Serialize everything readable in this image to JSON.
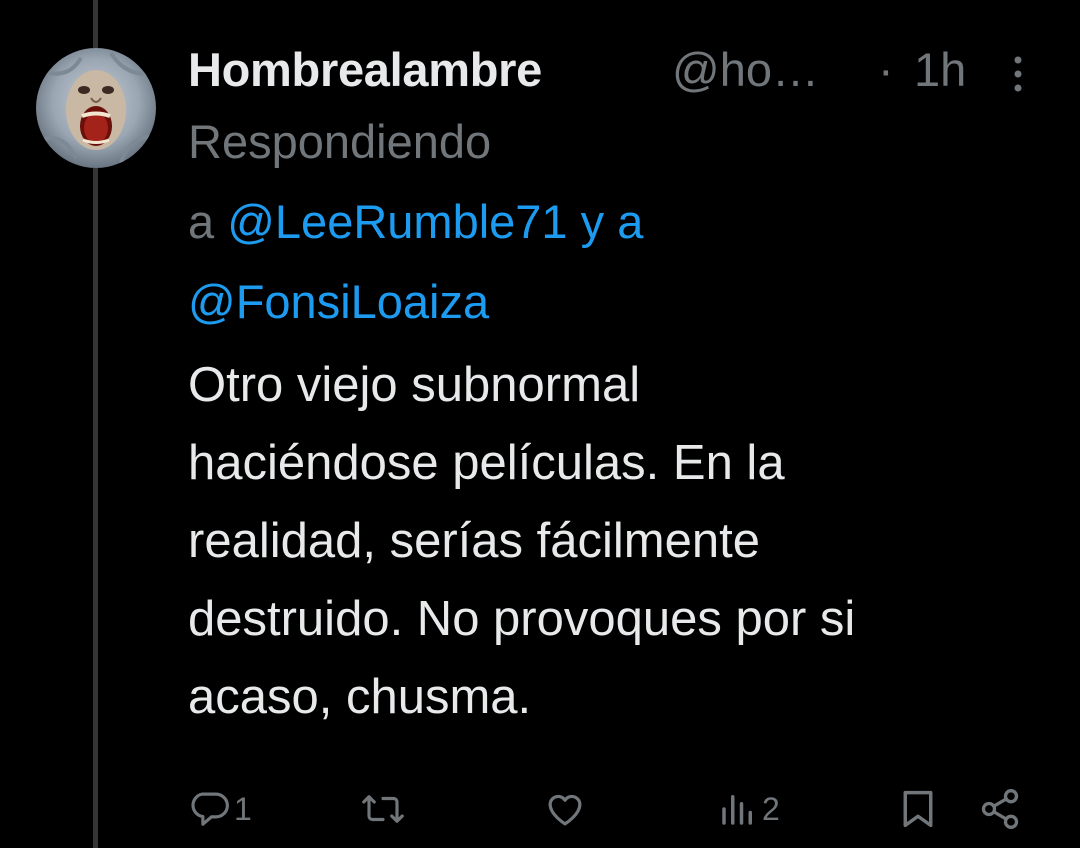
{
  "tweet": {
    "author": {
      "name": "Hombrealambre",
      "handle": "@ho…",
      "avatar_icon": "screaming-face-avatar"
    },
    "separator": "·",
    "time": "1h",
    "replying": {
      "label": "Respondiendo",
      "prefix": "a",
      "mention_1": "@LeeRumble71",
      "conjunction": "y a",
      "mention_2": "@FonsiLoaiza"
    },
    "text_lines": [
      "Otro viejo subnormal",
      "haciéndose películas. En la",
      "realidad, serías fácilmente",
      "destruido. No provoques por si",
      "acaso, chusma."
    ],
    "actions": {
      "reply_count": "1",
      "retweet_count": "",
      "like_count": "",
      "views_count": "2"
    }
  },
  "colors": {
    "background": "#000000",
    "text_primary": "#e7e9ea",
    "text_secondary": "#71767b",
    "accent": "#1d9bf0",
    "thread_line": "#333639"
  }
}
